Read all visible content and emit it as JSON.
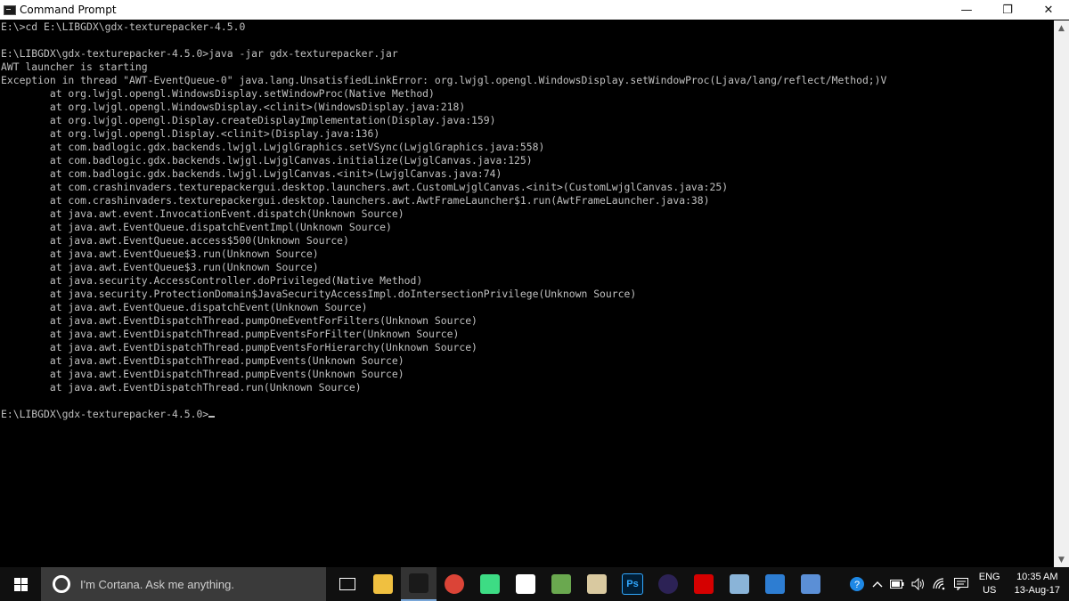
{
  "window": {
    "title": "Command Prompt",
    "minimize_glyph": "—",
    "restore_glyph": "❐",
    "close_glyph": "✕"
  },
  "console": {
    "lines": [
      "E:\\>cd E:\\LIBGDX\\gdx-texturepacker-4.5.0",
      "",
      "E:\\LIBGDX\\gdx-texturepacker-4.5.0>java -jar gdx-texturepacker.jar",
      "AWT launcher is starting",
      "Exception in thread \"AWT-EventQueue-0\" java.lang.UnsatisfiedLinkError: org.lwjgl.opengl.WindowsDisplay.setWindowProc(Ljava/lang/reflect/Method;)V",
      "        at org.lwjgl.opengl.WindowsDisplay.setWindowProc(Native Method)",
      "        at org.lwjgl.opengl.WindowsDisplay.<clinit>(WindowsDisplay.java:218)",
      "        at org.lwjgl.opengl.Display.createDisplayImplementation(Display.java:159)",
      "        at org.lwjgl.opengl.Display.<clinit>(Display.java:136)",
      "        at com.badlogic.gdx.backends.lwjgl.LwjglGraphics.setVSync(LwjglGraphics.java:558)",
      "        at com.badlogic.gdx.backends.lwjgl.LwjglCanvas.initialize(LwjglCanvas.java:125)",
      "        at com.badlogic.gdx.backends.lwjgl.LwjglCanvas.<init>(LwjglCanvas.java:74)",
      "        at com.crashinvaders.texturepackergui.desktop.launchers.awt.CustomLwjglCanvas.<init>(CustomLwjglCanvas.java:25)",
      "        at com.crashinvaders.texturepackergui.desktop.launchers.awt.AwtFrameLauncher$1.run(AwtFrameLauncher.java:38)",
      "        at java.awt.event.InvocationEvent.dispatch(Unknown Source)",
      "        at java.awt.EventQueue.dispatchEventImpl(Unknown Source)",
      "        at java.awt.EventQueue.access$500(Unknown Source)",
      "        at java.awt.EventQueue$3.run(Unknown Source)",
      "        at java.awt.EventQueue$3.run(Unknown Source)",
      "        at java.security.AccessController.doPrivileged(Native Method)",
      "        at java.security.ProtectionDomain$JavaSecurityAccessImpl.doIntersectionPrivilege(Unknown Source)",
      "        at java.awt.EventQueue.dispatchEvent(Unknown Source)",
      "        at java.awt.EventDispatchThread.pumpOneEventForFilters(Unknown Source)",
      "        at java.awt.EventDispatchThread.pumpEventsForFilter(Unknown Source)",
      "        at java.awt.EventDispatchThread.pumpEventsForHierarchy(Unknown Source)",
      "        at java.awt.EventDispatchThread.pumpEvents(Unknown Source)",
      "        at java.awt.EventDispatchThread.pumpEvents(Unknown Source)",
      "        at java.awt.EventDispatchThread.run(Unknown Source)",
      ""
    ],
    "prompt": "E:\\LIBGDX\\gdx-texturepacker-4.5.0>"
  },
  "scrollbar": {
    "up_glyph": "▲",
    "down_glyph": "▼"
  },
  "taskbar": {
    "search_placeholder": "I'm Cortana. Ask me anything.",
    "apps": [
      {
        "name": "task-view-icon",
        "label": "",
        "color": "#101010",
        "active": false
      },
      {
        "name": "file-explorer-icon",
        "label": "",
        "color": "#f0c040",
        "active": false
      },
      {
        "name": "command-prompt-icon",
        "label": "",
        "color": "#1a1a1a",
        "active": true
      },
      {
        "name": "chrome-icon",
        "label": "",
        "color": "#db4437",
        "active": false
      },
      {
        "name": "android-studio-icon",
        "label": "",
        "color": "#3ddc84",
        "active": false
      },
      {
        "name": "calculator-icon",
        "label": "",
        "color": "#ffffff",
        "active": false
      },
      {
        "name": "image-editor-icon",
        "label": "",
        "color": "#6aa84f",
        "active": false
      },
      {
        "name": "notepad-app-icon",
        "label": "",
        "color": "#d9c9a0",
        "active": false
      },
      {
        "name": "photoshop-icon",
        "label": "Ps",
        "color": "#001e36",
        "active": false
      },
      {
        "name": "eclipse-icon",
        "label": "",
        "color": "#2c2255",
        "active": false
      },
      {
        "name": "acrobat-icon",
        "label": "",
        "color": "#d50000",
        "active": false
      },
      {
        "name": "notes-icon",
        "label": "",
        "color": "#8ab4d8",
        "active": false
      },
      {
        "name": "network-tool-icon",
        "label": "",
        "color": "#2d7dd2",
        "active": false
      },
      {
        "name": "remote-desktop-icon",
        "label": "",
        "color": "#5b8fd6",
        "active": false
      }
    ],
    "tray": {
      "lang_top": "ENG",
      "lang_bottom": "US",
      "time": "10:35 AM",
      "date": "13-Aug-17"
    }
  }
}
